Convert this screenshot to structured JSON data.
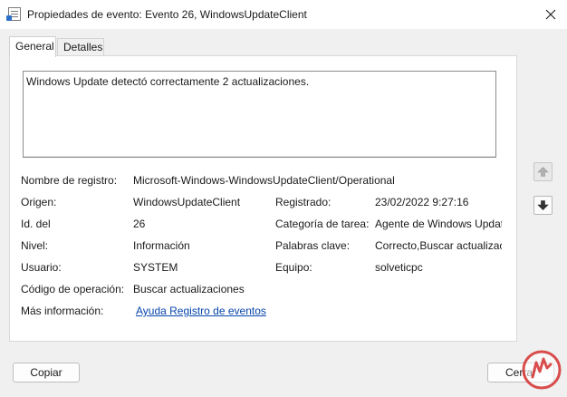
{
  "window": {
    "title": "Propiedades de evento: Evento 26, WindowsUpdateClient"
  },
  "tabs": [
    {
      "label": "General",
      "active": true
    },
    {
      "label": "Detalles",
      "active": false
    }
  ],
  "description": "Windows Update detectó correctamente 2 actualizaciones.",
  "fields": {
    "log_name_label": "Nombre de registro:",
    "log_name_value": "Microsoft-Windows-WindowsUpdateClient/Operational",
    "source_label": "Origen:",
    "source_value": "WindowsUpdateClient",
    "logged_label": "Registrado:",
    "logged_value": "23/02/2022 9:27:16",
    "event_id_label": "Id. del",
    "event_id_value": "26",
    "task_category_label": "Categoría de tarea:",
    "task_category_value": "Agente de Windows Update",
    "level_label": "Nivel:",
    "level_value": "Información",
    "keywords_label": "Palabras clave:",
    "keywords_value": "Correcto,Buscar actualizaciones",
    "user_label": "Usuario:",
    "user_value": "SYSTEM",
    "computer_label": "Equipo:",
    "computer_value": "solveticpc",
    "opcode_label": "Código de operación:",
    "opcode_value": "Buscar actualizaciones",
    "more_info_label": "Más información:",
    "more_info_link": "Ayuda Registro de eventos"
  },
  "buttons": {
    "copy": "Copiar",
    "close": "Cerrar"
  },
  "icons": {
    "app": "event-properties-icon",
    "close": "close-icon",
    "up": "arrow-up-icon",
    "down": "arrow-down-icon",
    "watermark": "solvetic-logo"
  },
  "colors": {
    "link": "#0645ad",
    "watermark": "#d32f2f"
  }
}
